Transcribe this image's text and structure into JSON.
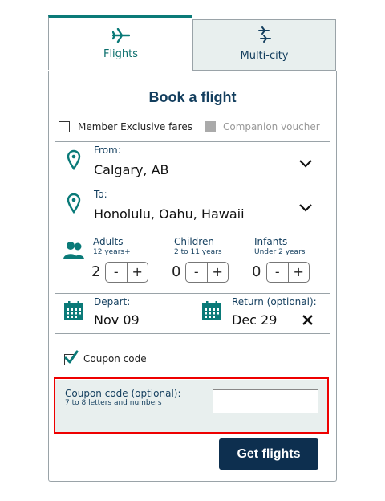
{
  "tabs": [
    {
      "label": "Flights",
      "icon": "airplane-icon",
      "active": true
    },
    {
      "label": "Multi-city",
      "icon": "multi-city-icon",
      "active": false
    }
  ],
  "title": "Book a flight",
  "options": {
    "member_exclusive": {
      "label": "Member Exclusive fares",
      "checked": false
    },
    "companion_voucher": {
      "label": "Companion voucher",
      "disabled": true
    }
  },
  "from": {
    "label": "From:",
    "value": "Calgary, AB"
  },
  "to": {
    "label": "To:",
    "value": "Honolulu, Oahu, Hawaii"
  },
  "passengers": {
    "adults": {
      "label": "Adults",
      "sublabel": "12 years+",
      "count": "2"
    },
    "children": {
      "label": "Children",
      "sublabel": "2 to 11 years",
      "count": "0"
    },
    "infants": {
      "label": "Infants",
      "sublabel": "Under 2 years",
      "count": "0"
    },
    "minus": "-",
    "plus": "+"
  },
  "depart": {
    "label": "Depart:",
    "value": "Nov 09"
  },
  "return": {
    "label": "Return (optional):",
    "value": "Dec 29"
  },
  "coupon": {
    "checkbox_label": "Coupon code",
    "checked": true,
    "field_label": "Coupon code (optional):",
    "field_hint": "7 to 8 letters and numbers",
    "value": ""
  },
  "submit_label": "Get flights",
  "colors": {
    "accent": "#0a7a78",
    "navy": "#133e5e",
    "button": "#0d2f4f",
    "panel": "#e8efee",
    "highlight": "#ee0000"
  }
}
